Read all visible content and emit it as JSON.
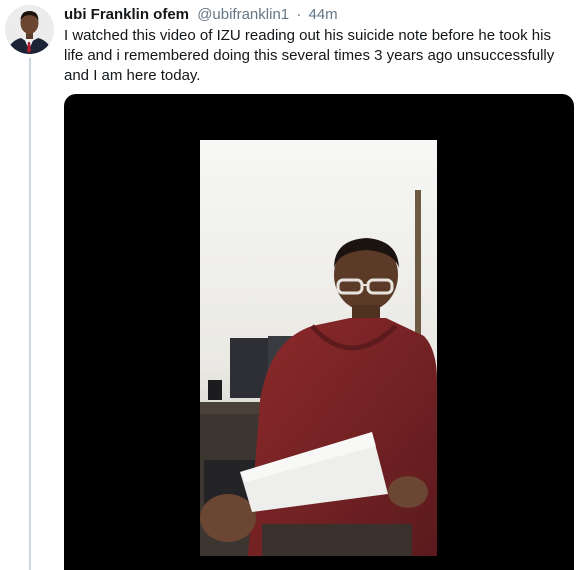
{
  "tweet": {
    "display_name": "ubi Franklin ofem",
    "handle": "@ubifranklin1",
    "separator": "·",
    "timestamp": "44m",
    "text": "I watched this video of IZU reading out his suicide note before he took his life and i remembered doing this several times 3 years ago unsuccessfully and I am here today."
  },
  "icons": {
    "avatar": "avatar-photo",
    "video": "video-thumbnail"
  },
  "colors": {
    "name": "#14171a",
    "muted": "#657786",
    "thread_line": "#ccd6dd",
    "media_background": "#000000"
  }
}
